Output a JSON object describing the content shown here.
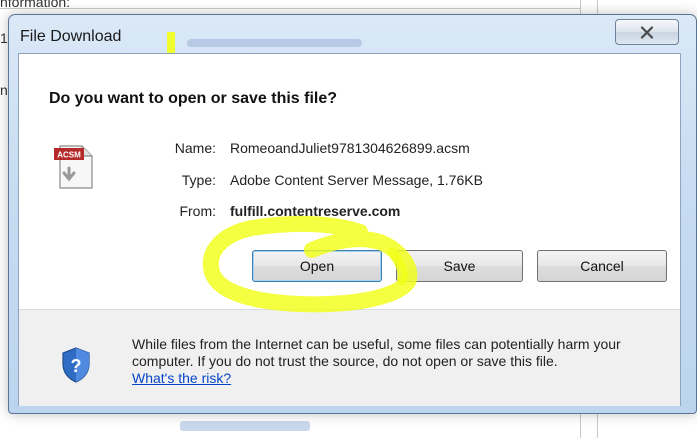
{
  "background": {
    "snippet_top": "nformation:",
    "snippet_left_1": "1",
    "snippet_left_2": "n"
  },
  "dialog": {
    "title": "File Download",
    "question": "Do you want to open or save this file?",
    "file_icon_label": "ACSM",
    "fields": {
      "name_label": "Name:",
      "name_value": "RomeoandJuliet9781304626899.acsm",
      "type_label": "Type:",
      "type_value": "Adobe Content Server Message, 1.76KB",
      "from_label": "From:",
      "from_value": "fulfill.contentreserve.com"
    },
    "buttons": {
      "open": "Open",
      "save": "Save",
      "cancel": "Cancel"
    },
    "warning": {
      "text": "While files from the Internet can be useful, some files can potentially harm your computer. If you do not trust the source, do not open or save this file.",
      "link": "What's the risk?"
    }
  },
  "colors": {
    "highlight": "#f2ff18",
    "link": "#0645c8",
    "frame": "#c7dcf1"
  },
  "icons": [
    "close-icon",
    "acsm-file-icon",
    "security-shield-icon"
  ]
}
